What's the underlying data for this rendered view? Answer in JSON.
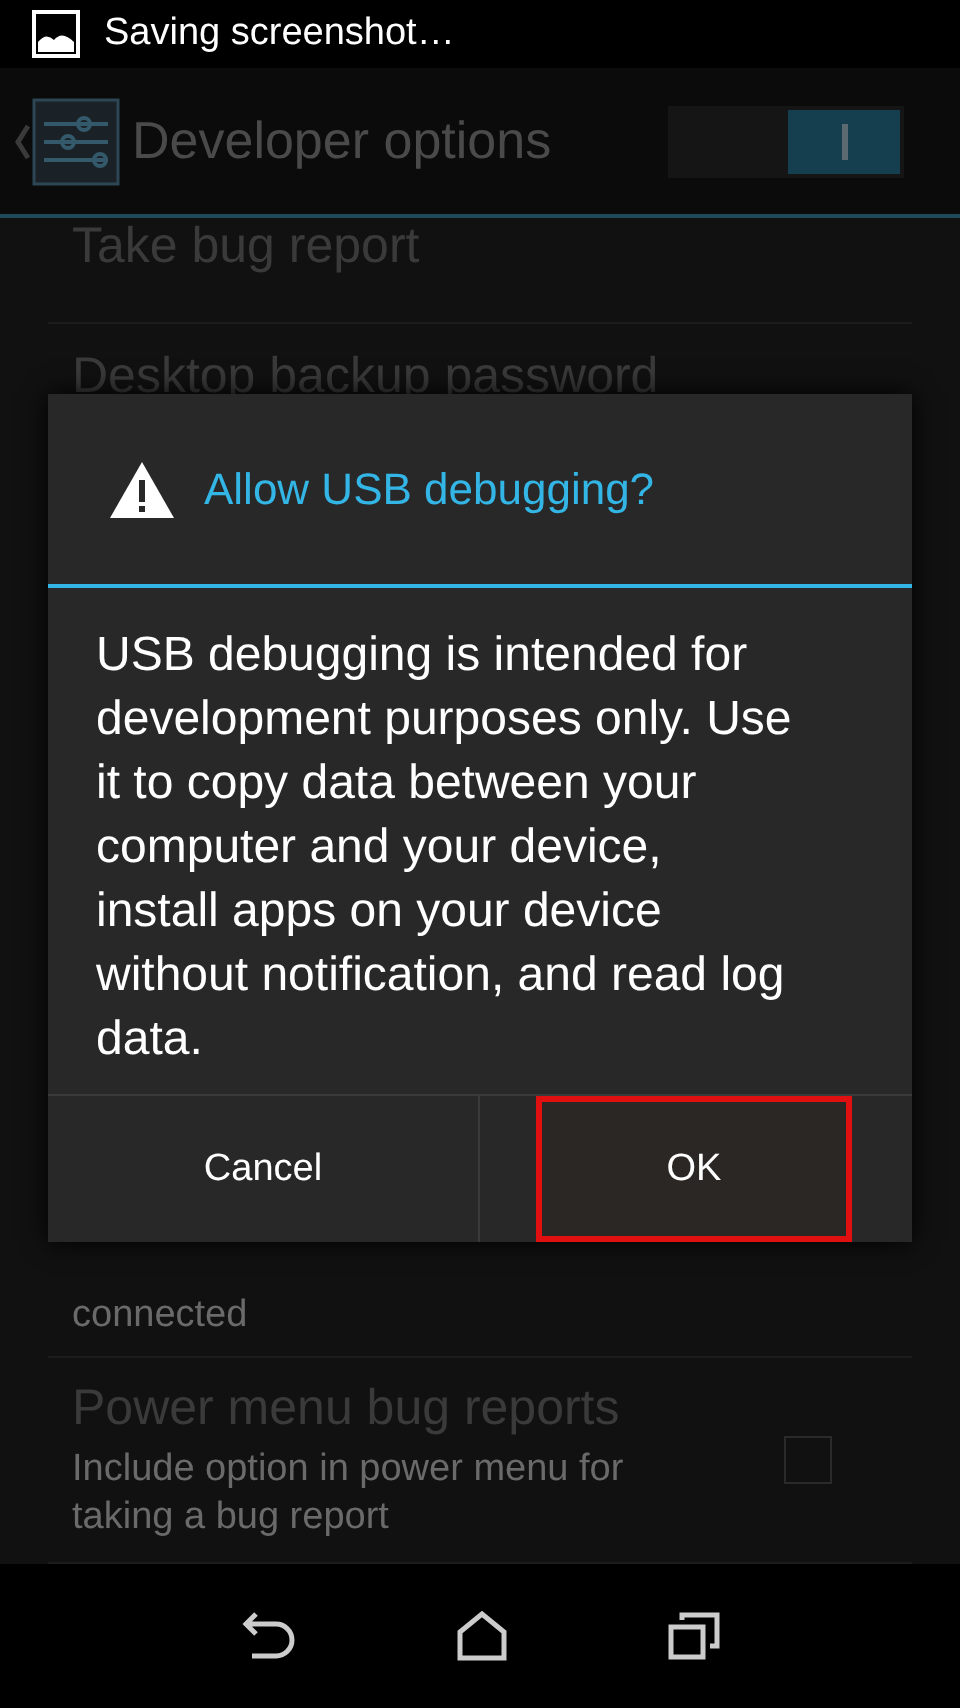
{
  "status_bar": {
    "notification": "Saving screenshot…"
  },
  "action_bar": {
    "title": "Developer options",
    "toggle_on": true
  },
  "settings": [
    {
      "kind": "plain",
      "title": "Take bug report"
    },
    {
      "kind": "plain",
      "title": "Desktop backup password"
    },
    {
      "kind": "covered",
      "summary": "connected"
    },
    {
      "kind": "checkbox",
      "title": "Power menu bug reports",
      "summary": "Include option in power menu for taking a bug report",
      "checked": false
    }
  ],
  "dialog": {
    "title": "Allow USB debugging?",
    "message": "USB debugging is intended for development purposes only. Use it to copy data between your computer and your device, install apps on your device without notification, and read log data.",
    "buttons": [
      {
        "label": "Cancel",
        "highlighted": false
      },
      {
        "label": "OK",
        "highlighted": true
      }
    ]
  }
}
